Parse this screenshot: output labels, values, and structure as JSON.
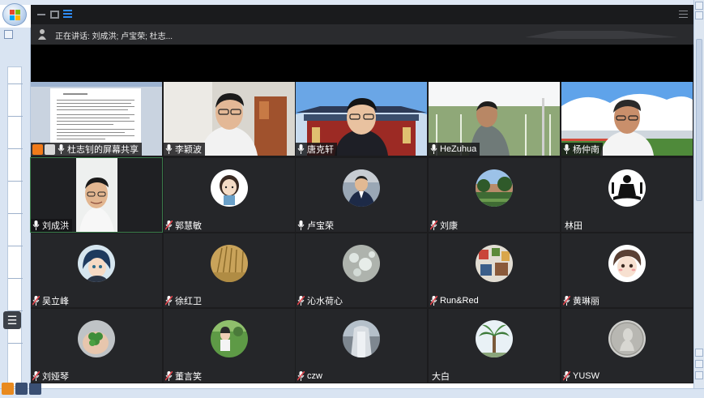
{
  "meeting": {
    "speaking_label": "正在讲话: 刘成洪; 卢宝荣; 杜志...",
    "accent": "#2f8cf5"
  },
  "participants": [
    {
      "name": "杜志钊的屏幕共享",
      "mic": "on",
      "type": "screen-share"
    },
    {
      "name": "李颖波",
      "mic": "on",
      "type": "video"
    },
    {
      "name": "唐克轩",
      "mic": "on",
      "type": "video"
    },
    {
      "name": "HeZuhua",
      "mic": "on",
      "type": "video"
    },
    {
      "name": "杨仲南",
      "mic": "on",
      "type": "video"
    },
    {
      "name": "刘成洪",
      "mic": "on",
      "type": "video"
    },
    {
      "name": "郭慧敏",
      "mic": "muted",
      "type": "avatar",
      "icon": "cartoon-girl-icon"
    },
    {
      "name": "卢宝荣",
      "mic": "on",
      "type": "avatar",
      "icon": "man-suit-icon"
    },
    {
      "name": "刘康",
      "mic": "muted",
      "type": "avatar",
      "icon": "campus-photo-icon"
    },
    {
      "name": "林田",
      "mic": "none",
      "type": "avatar",
      "icon": "meditation-icon"
    },
    {
      "name": "吴立峰",
      "mic": "muted",
      "type": "avatar",
      "icon": "anime-boy-icon"
    },
    {
      "name": "徐红卫",
      "mic": "muted",
      "type": "avatar",
      "icon": "wheat-icon"
    },
    {
      "name": "沁水荷心",
      "mic": "muted",
      "type": "avatar",
      "icon": "water-drops-icon"
    },
    {
      "name": "Run&Red",
      "mic": "muted",
      "type": "avatar",
      "icon": "collage-icon"
    },
    {
      "name": "黄琳丽",
      "mic": "muted",
      "type": "avatar",
      "icon": "cartoon-face-icon"
    },
    {
      "name": "刘娅琴",
      "mic": "muted",
      "type": "avatar",
      "icon": "clover-hand-icon"
    },
    {
      "name": "董言笑",
      "mic": "muted",
      "type": "avatar",
      "icon": "child-garden-icon"
    },
    {
      "name": "czw",
      "mic": "muted",
      "type": "avatar",
      "icon": "building-icon"
    },
    {
      "name": "大白",
      "mic": "none",
      "type": "avatar",
      "icon": "palm-tree-icon"
    },
    {
      "name": "YUSW",
      "mic": "muted",
      "type": "avatar",
      "icon": "coin-portrait-icon"
    }
  ]
}
